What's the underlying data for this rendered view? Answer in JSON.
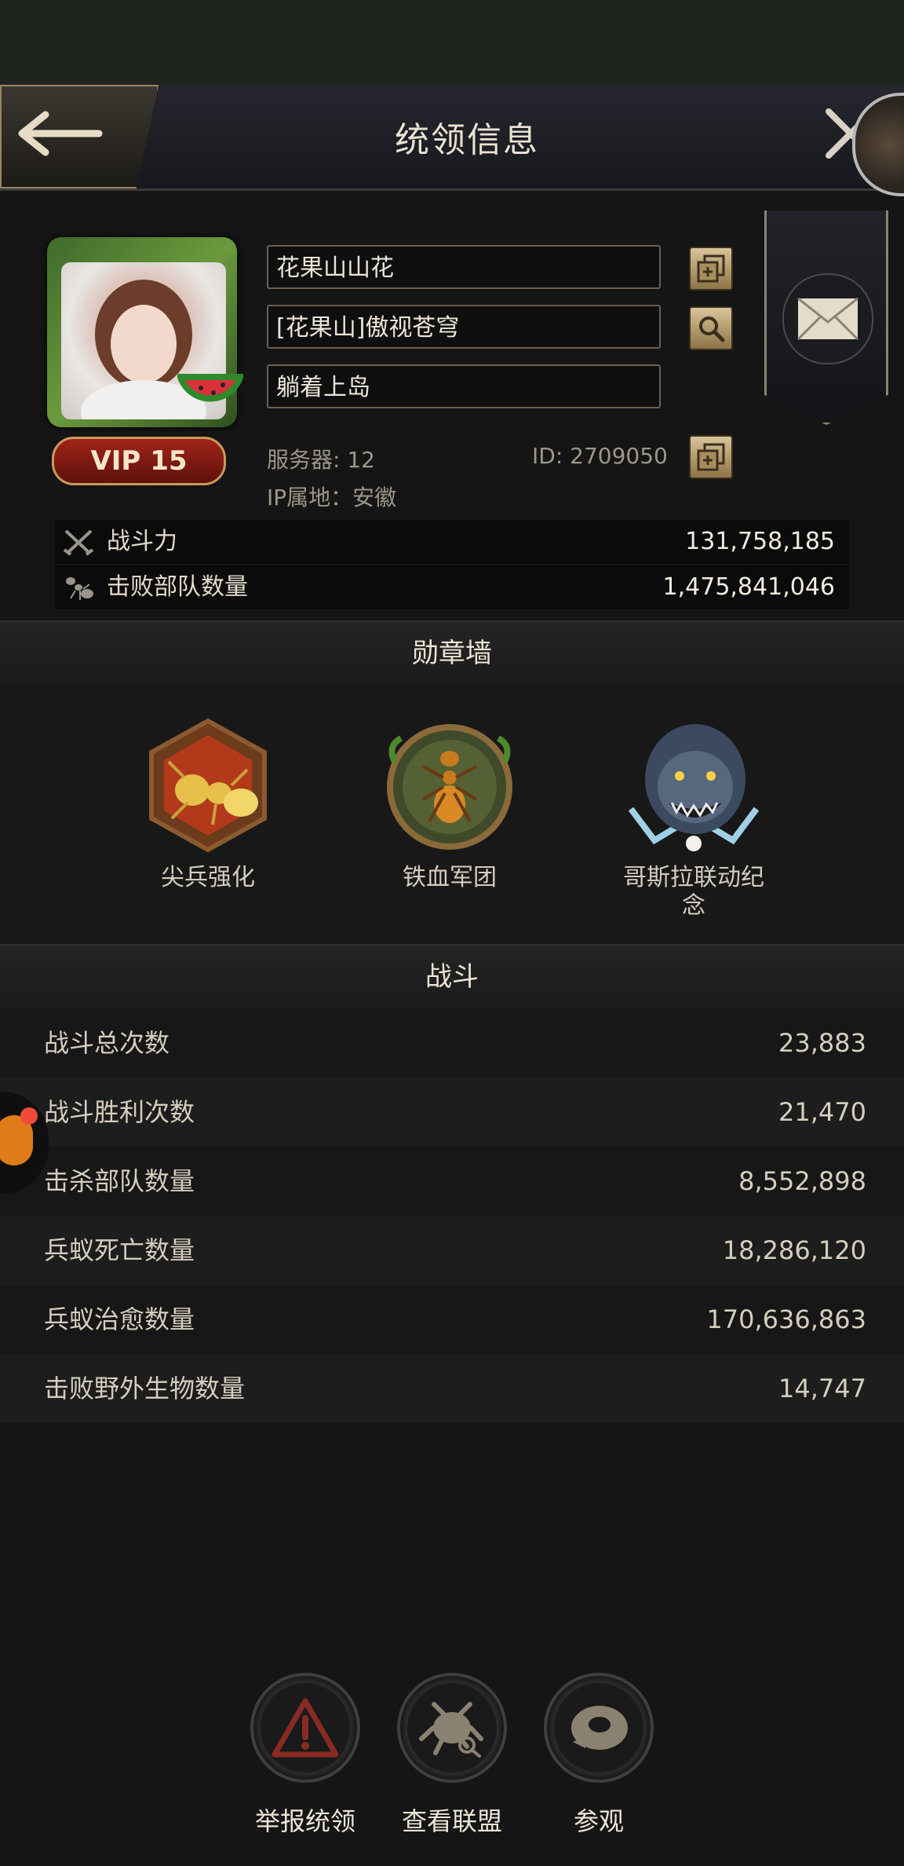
{
  "header": {
    "title": "统领信息"
  },
  "profile": {
    "vip": "VIP 15",
    "name": "花果山山花",
    "alliance": "[花果山]傲视苍穹",
    "signature": "躺着上岛",
    "server": "服务器: 12",
    "id": "ID: 2709050",
    "ip_location": "IP属地：安徽"
  },
  "stats": [
    {
      "label": "战斗力",
      "value": "131,758,185",
      "icon": "crossed-swords-icon"
    },
    {
      "label": "击败部队数量",
      "value": "1,475,841,046",
      "icon": "ant-icon"
    }
  ],
  "medal_wall": {
    "title": "勋章墙",
    "medals": [
      {
        "label": "尖兵强化",
        "icon": "golden-ant-hexagon-medal"
      },
      {
        "label": "铁血军团",
        "icon": "ant-wreath-medal"
      },
      {
        "label": "哥斯拉联动纪\n念",
        "icon": "godzilla-medal"
      }
    ]
  },
  "battle": {
    "title": "战斗",
    "rows": [
      {
        "label": "战斗总次数",
        "value": "23,883"
      },
      {
        "label": "战斗胜利次数",
        "value": "21,470"
      },
      {
        "label": "击杀部队数量",
        "value": "8,552,898"
      },
      {
        "label": "兵蚁死亡数量",
        "value": "18,286,120"
      },
      {
        "label": "兵蚁治愈数量",
        "value": "170,636,863"
      },
      {
        "label": "击败野外生物数量",
        "value": "14,747"
      }
    ]
  },
  "actions": [
    {
      "label": "举报统领",
      "icon": "warning-triangle-icon"
    },
    {
      "label": "查看联盟",
      "icon": "alliance-search-icon"
    },
    {
      "label": "参观",
      "icon": "visit-icon"
    }
  ],
  "colors": {
    "gold": "#c7ab78",
    "background": "#151515",
    "vip_red": "#a12318"
  }
}
